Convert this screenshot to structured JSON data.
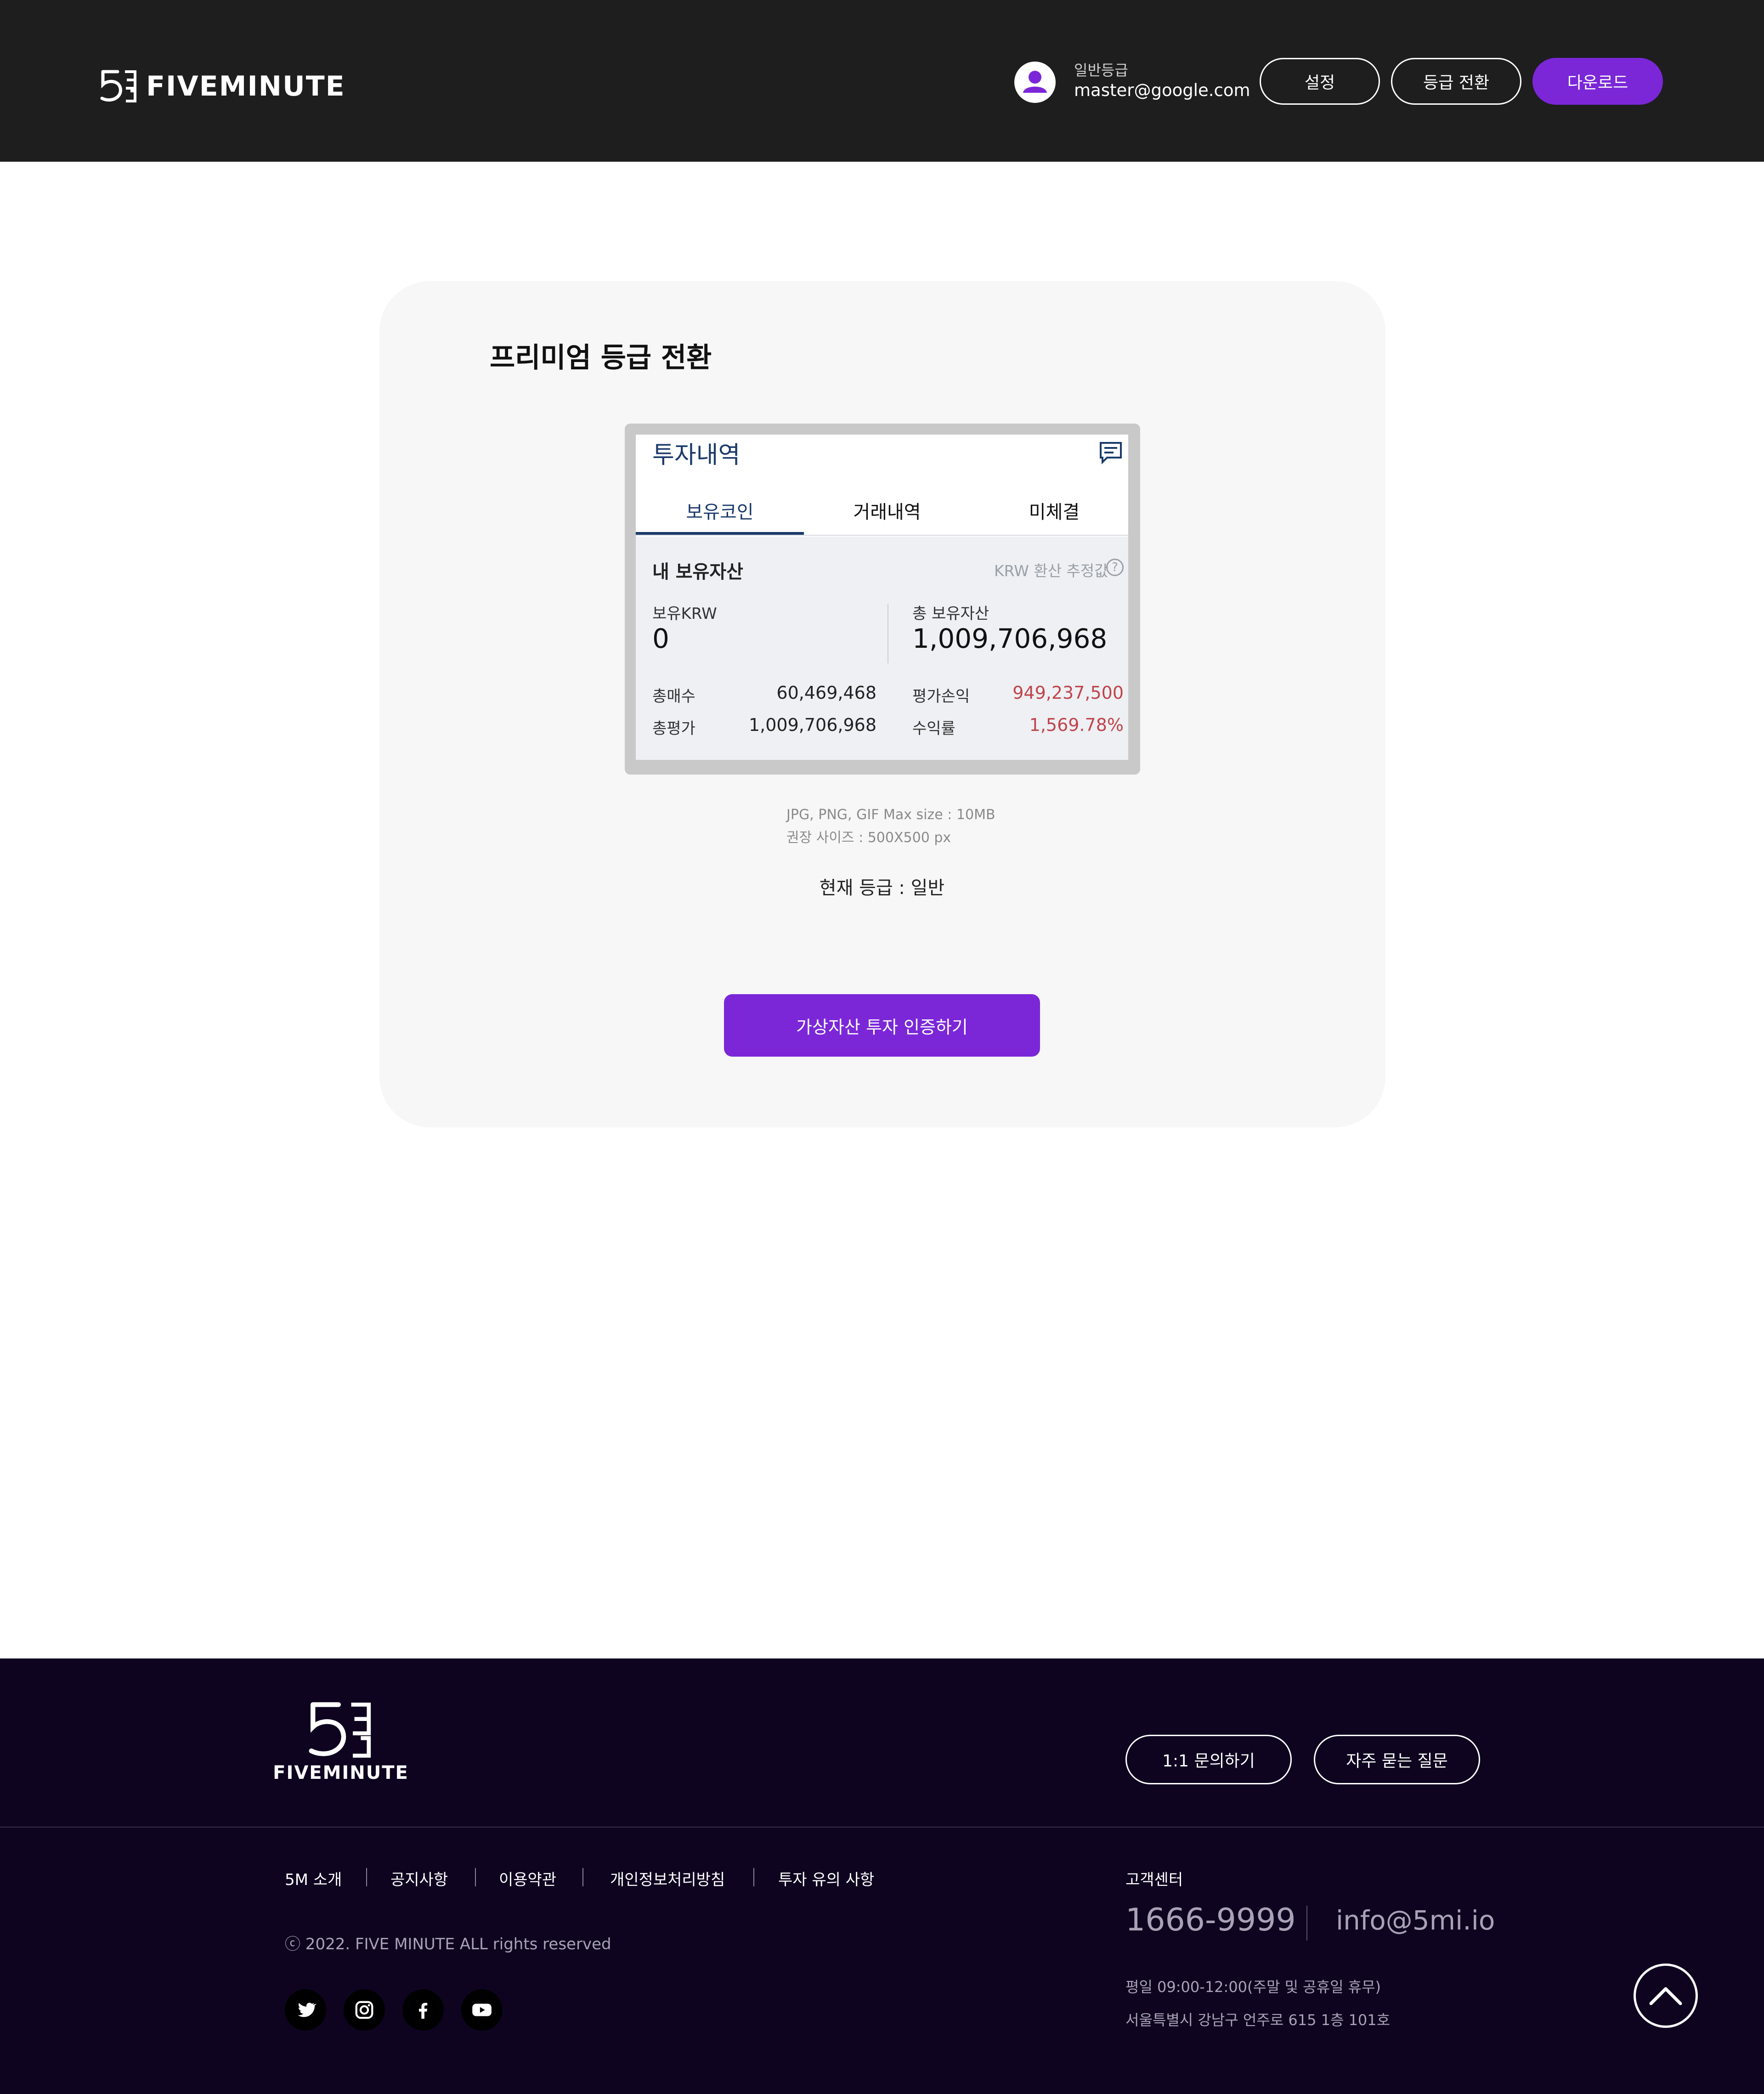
{
  "header": {
    "brand": "FIVEMINUTE",
    "user_grade": "일반등급",
    "user_email": "master@google.com",
    "settings_label": "설정",
    "grade_switch_label": "등급 전환",
    "download_label": "다운로드"
  },
  "main": {
    "title": "프리미엄 등급 전환",
    "hint_formats": "JPG, PNG, GIF Max size : 10MB",
    "hint_size": "권장 사이즈 : 500X500 px",
    "current_grade": "현재 등급 : 일반",
    "verify_label": "가상자산 투자 인증하기"
  },
  "screenshot": {
    "title": "투자내역",
    "tabs": [
      "보유코인",
      "거래내역",
      "미체결"
    ],
    "section_title": "내 보유자산",
    "krw_note": "KRW 환산 추정값",
    "help_glyph": "?",
    "held_krw_label": "보유KRW",
    "held_krw_value": "0",
    "total_assets_label": "총 보유자산",
    "total_assets_value": "1,009,706,968",
    "total_buy_label": "총매수",
    "total_buy_value": "60,469,468",
    "total_eval_label": "총평가",
    "total_eval_value": "1,009,706,968",
    "pnl_label": "평가손익",
    "pnl_value": "949,237,500",
    "return_label": "수익률",
    "return_value": "1,569.78%"
  },
  "footer": {
    "brand": "FIVEMINUTE",
    "inquiry_label": "1:1 문의하기",
    "faq_label": "자주 묻는 질문",
    "links": [
      "5M 소개",
      "공지사항",
      "이용약관",
      "개인정보처리방침",
      "투자 유의 사항"
    ],
    "copyright": "ⓒ 2022. FIVE MINUTE ALL rights reserved",
    "cs_title": "고객센터",
    "cs_phone": "1666-9999",
    "cs_email": "info@5mi.io",
    "cs_hours": "평일 09:00-12:00(주말 및 공휴일 휴무)",
    "cs_address": "서울특별시  강남구 언주로 615 1층 101호"
  },
  "colors": {
    "accent": "#7b27d8",
    "header_bg": "#1e1e1e",
    "footer_bg": "#0e0420",
    "profit_red": "#c0444c",
    "navy": "#1b3a6b"
  },
  "icons": [
    "user-icon",
    "chat-icon",
    "help-icon",
    "twitter-icon",
    "instagram-icon",
    "facebook-icon",
    "youtube-icon",
    "chevron-up-icon"
  ]
}
